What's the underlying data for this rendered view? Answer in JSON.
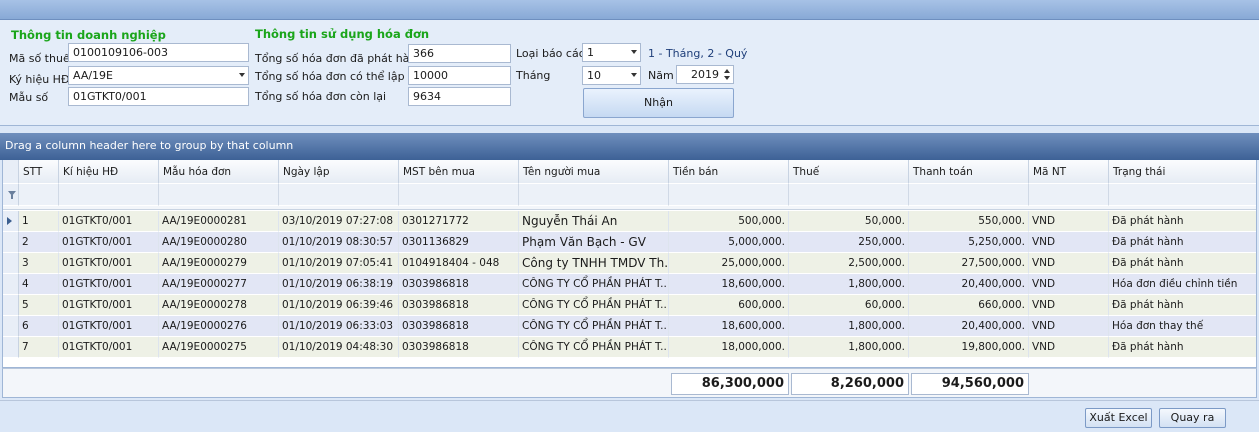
{
  "company": {
    "title": "Thông tin doanh nghiệp",
    "tax_code_label": "Mã số thuế",
    "tax_code": "0100109106-003",
    "symbol_label": "Ký hiệu HĐ",
    "symbol": "AA/19E",
    "template_label": "Mẫu số",
    "template": "01GTKT0/001"
  },
  "usage": {
    "title": "Thông tin sử dụng hóa đơn",
    "issued_label": "Tổng số hóa đơn đã phát hành",
    "issued": "366",
    "available_label": "Tổng số hóa đơn có thể lập",
    "available": "10000",
    "remaining_label": "Tổng số hóa đơn còn lại",
    "remaining": "9634"
  },
  "report": {
    "type_label": "Loại báo cáo",
    "type_value": "1",
    "type_hint": "1 - Tháng, 2 - Quý",
    "month_label": "Tháng",
    "month_value": "10",
    "year_label": "Năm",
    "year_value": "2019",
    "submit_label": "Nhận"
  },
  "grid": {
    "group_hint": "Drag a column header here to group by that column",
    "columns": [
      "STT",
      "Kí hiệu HĐ",
      "Mẫu hóa đơn",
      "Ngày lập",
      "MST bên mua",
      "Tên người mua",
      "Tiền bán",
      "Thuế",
      "Thanh toán",
      "Mã NT",
      "Trạng thái"
    ],
    "rows": [
      [
        "1",
        "01GTKT0/001",
        "AA/19E0000281",
        "03/10/2019 07:27:08",
        "0301271772",
        "Nguyễn Thái An",
        "500,000.",
        "50,000.",
        "550,000.",
        "VND",
        "Đã phát hành"
      ],
      [
        "2",
        "01GTKT0/001",
        "AA/19E0000280",
        "01/10/2019 08:30:57",
        "0301136829",
        "Phạm Văn Bạch - GV",
        "5,000,000.",
        "250,000.",
        "5,250,000.",
        "VND",
        "Đã phát hành"
      ],
      [
        "3",
        "01GTKT0/001",
        "AA/19E0000279",
        "01/10/2019 07:05:41",
        "0104918404 - 048",
        "Công ty TNHH TMDV Th...",
        "25,000,000.",
        "2,500,000.",
        "27,500,000.",
        "VND",
        "Đã phát hành"
      ],
      [
        "4",
        "01GTKT0/001",
        "AA/19E0000277",
        "01/10/2019 06:38:19",
        "0303986818",
        "CÔNG TY CỔ PHẦN PHÁT T...",
        "18,600,000.",
        "1,800,000.",
        "20,400,000.",
        "VND",
        "Hóa đơn điều chỉnh tiền"
      ],
      [
        "5",
        "01GTKT0/001",
        "AA/19E0000278",
        "01/10/2019 06:39:46",
        "0303986818",
        "CÔNG TY CỔ PHẦN PHÁT T...",
        "600,000.",
        "60,000.",
        "660,000.",
        "VND",
        "Đã phát hành"
      ],
      [
        "6",
        "01GTKT0/001",
        "AA/19E0000276",
        "01/10/2019 06:33:03",
        "0303986818",
        "CÔNG TY CỔ PHẦN PHÁT T...",
        "18,600,000.",
        "1,800,000.",
        "20,400,000.",
        "VND",
        "Hóa đơn thay thế"
      ],
      [
        "7",
        "01GTKT0/001",
        "AA/19E0000275",
        "01/10/2019 04:48:30",
        "0303986818",
        "CÔNG TY CỔ PHẦN PHÁT T...",
        "18,000,000.",
        "1,800,000.",
        "19,800,000.",
        "VND",
        "Đã phát hành"
      ]
    ],
    "totals": {
      "sales": "86,300,000",
      "tax": "8,260,000",
      "payment": "94,560,000"
    }
  },
  "buttons": {
    "export_label": "Xuất Excel",
    "back_label": "Quay ra"
  },
  "colors": {
    "section_title": "#1aa51a",
    "group_panel": "#3d6196"
  }
}
